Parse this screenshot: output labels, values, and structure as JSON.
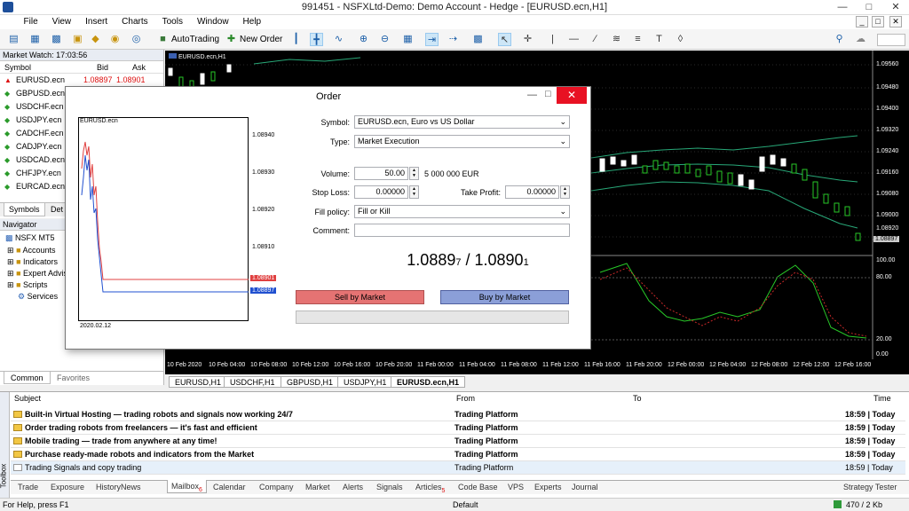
{
  "window": {
    "title": "991451 - NSFXLtd-Demo: Demo Account - Hedge - [EURUSD.ecn,H1]",
    "min_icon": "minimize-icon",
    "max_icon": "maximize-icon",
    "close_icon": "close-icon"
  },
  "menu": [
    "File",
    "View",
    "Insert",
    "Charts",
    "Tools",
    "Window",
    "Help"
  ],
  "toolbar": {
    "autotrading": "AutoTrading",
    "new_order": "New Order"
  },
  "market_watch": {
    "header": "Market Watch: 17:03:56",
    "col_symbol": "Symbol",
    "col_bid": "Bid",
    "col_ask": "Ask",
    "rows": [
      {
        "symbol": "EURUSD.ecn",
        "bid": "1.08897",
        "ask": "1.08901"
      },
      {
        "symbol": "GBPUSD.ecn",
        "bid": "",
        "ask": ""
      },
      {
        "symbol": "USDCHF.ecn",
        "bid": "",
        "ask": ""
      },
      {
        "symbol": "USDJPY.ecn",
        "bid": "",
        "ask": ""
      },
      {
        "symbol": "CADCHF.ecn",
        "bid": "",
        "ask": ""
      },
      {
        "symbol": "CADJPY.ecn",
        "bid": "",
        "ask": ""
      },
      {
        "symbol": "USDCAD.ecn",
        "bid": "",
        "ask": ""
      },
      {
        "symbol": "CHFJPY.ecn",
        "bid": "",
        "ask": ""
      },
      {
        "symbol": "EURCAD.ecn",
        "bid": "",
        "ask": ""
      }
    ],
    "tabs": [
      "Symbols",
      "Det"
    ]
  },
  "navigator": {
    "header": "Navigator",
    "root": "NSFX MT5",
    "items": [
      "Accounts",
      "Indicators",
      "Expert Advisors",
      "Scripts",
      "Services"
    ],
    "tabs": [
      "Common",
      "Favorites"
    ]
  },
  "chart": {
    "title": "EURUSD.ecn,H1",
    "price_labels": [
      "1.09560",
      "1.09480",
      "1.09400",
      "1.09320",
      "1.09240",
      "1.09160",
      "1.09080",
      "1.09000",
      "1.08920"
    ],
    "current_price": "1.08897",
    "osc_labels": [
      "100.00",
      "80.00",
      "20.00",
      "0.00"
    ],
    "time_labels": [
      "10 Feb 2020",
      "10 Feb 04:00",
      "10 Feb 08:00",
      "10 Feb 12:00",
      "10 Feb 16:00",
      "10 Feb 20:00",
      "11 Feb 00:00",
      "11 Feb 04:00",
      "11 Feb 08:00",
      "11 Feb 12:00",
      "11 Feb 16:00",
      "11 Feb 20:00",
      "12 Feb 00:00",
      "12 Feb 04:00",
      "12 Feb 08:00",
      "12 Feb 12:00",
      "12 Feb 16:00"
    ],
    "tabs": [
      "EURUSD,H1",
      "USDCHF,H1",
      "GBPUSD,H1",
      "USDJPY,H1",
      "EURUSD.ecn,H1"
    ]
  },
  "order": {
    "title": "Order",
    "tick_chart_title": "EURUSD.ecn",
    "tick_prices": [
      "1.08940",
      "1.08930",
      "1.08920",
      "1.08910"
    ],
    "tick_ask": "1.08901",
    "tick_bid": "1.08897",
    "tick_date": "2020.02.12",
    "symbol_label": "Symbol:",
    "symbol_value": "EURUSD.ecn, Euro vs US Dollar",
    "type_label": "Type:",
    "type_value": "Market Execution",
    "volume_label": "Volume:",
    "volume_value": "50.00",
    "volume_note": "5 000 000 EUR",
    "sl_label": "Stop Loss:",
    "sl_value": "0.00000",
    "tp_label": "Take Profit:",
    "tp_value": "0.00000",
    "fill_label": "Fill policy:",
    "fill_value": "Fill or Kill",
    "comment_label": "Comment:",
    "comment_value": "",
    "bid_main": "1.0889",
    "bid_small": "7",
    "sep": " / ",
    "ask_main": "1.0890",
    "ask_small": "1",
    "sell_label": "Sell by Market",
    "buy_label": "Buy by Market",
    "sell_color": "#e57373",
    "buy_color": "#8b9fd8"
  },
  "toolbox": {
    "col_subject": "Subject",
    "col_from": "From",
    "col_to": "To",
    "col_time": "Time",
    "side_label": "Toolbox",
    "rows": [
      {
        "subject": "Built-in Virtual Hosting — trading robots and signals now working 24/7",
        "from": "Trading Platform",
        "time": "18:59 | Today",
        "bold": true
      },
      {
        "subject": "Order trading robots from freelancers — it's fast and efficient",
        "from": "Trading Platform",
        "time": "18:59 | Today",
        "bold": true
      },
      {
        "subject": "Mobile trading — trade from anywhere at any time!",
        "from": "Trading Platform",
        "time": "18:59 | Today",
        "bold": true
      },
      {
        "subject": "Purchase ready-made robots and indicators from the Market",
        "from": "Trading Platform",
        "time": "18:59 | Today",
        "bold": true
      },
      {
        "subject": "Trading Signals and copy trading",
        "from": "Trading Platform",
        "time": "18:59 | Today",
        "bold": false
      }
    ],
    "tabs": [
      "Trade",
      "Exposure",
      "History",
      "News",
      "Mailbox",
      "Calendar",
      "Company",
      "Market",
      "Alerts",
      "Signals",
      "Articles",
      "Code Base",
      "VPS",
      "Experts",
      "Journal"
    ],
    "mailbox_badge": "6",
    "articles_badge": "5",
    "strategy_tester": "Strategy Tester"
  },
  "status": {
    "help": "For Help, press F1",
    "profile": "Default",
    "traffic": "470 / 2 Kb"
  }
}
